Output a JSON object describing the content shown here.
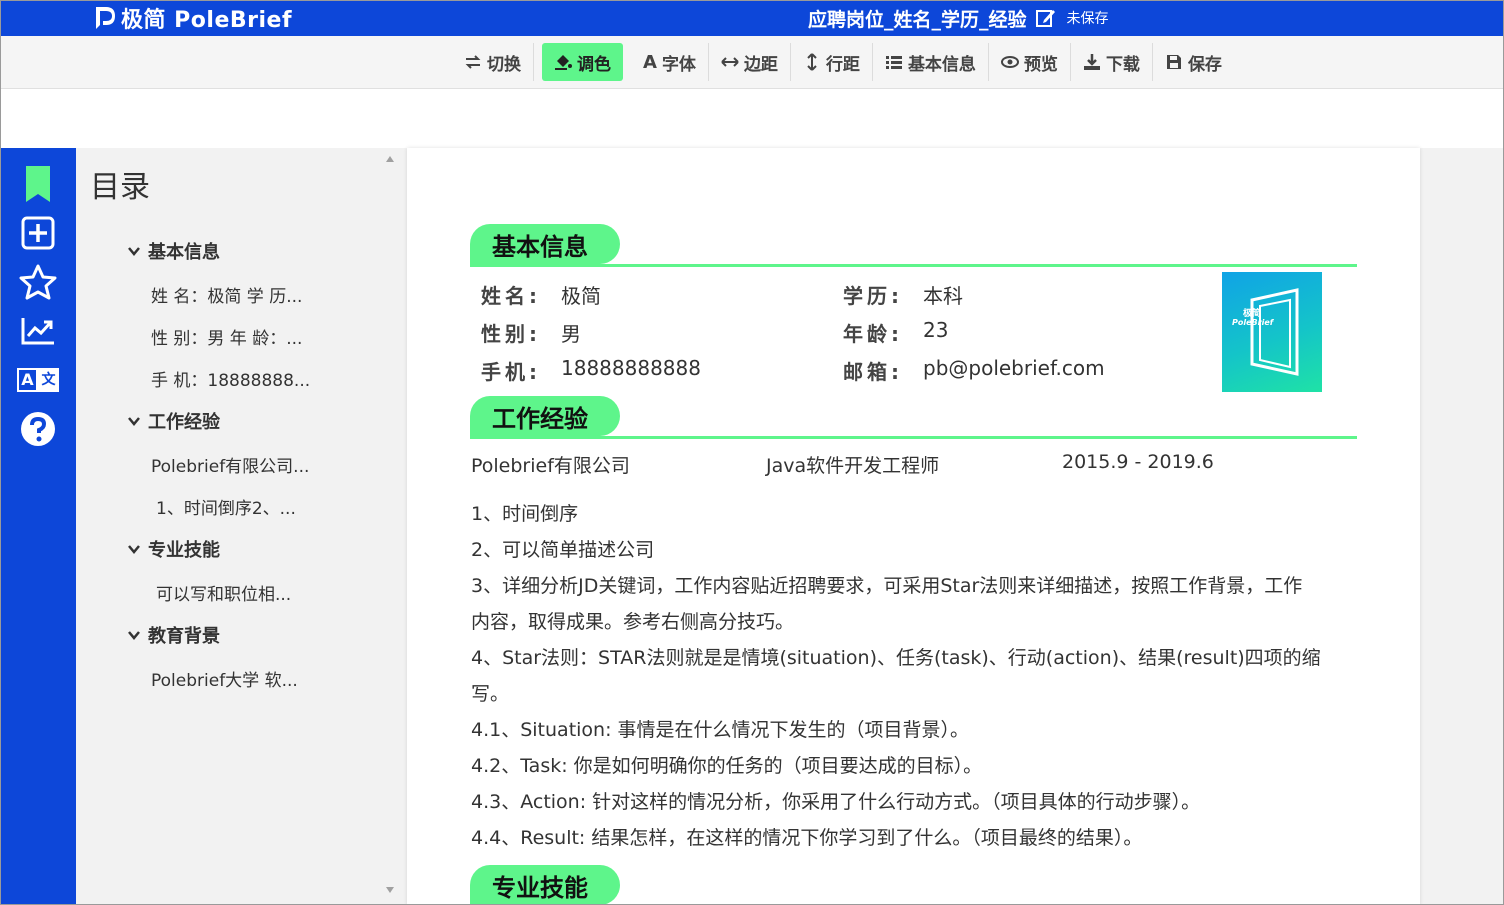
{
  "app": {
    "logo_text": "极简 PoleBrief",
    "doc_title": "应聘岗位_姓名_学历_经验",
    "save_status": "未保存"
  },
  "toolbar": {
    "items": [
      {
        "label": "切换",
        "icon": "swap-icon"
      },
      {
        "label": "调色",
        "icon": "paint-bucket-icon",
        "active": true
      },
      {
        "label": "字体",
        "icon": "font-icon"
      },
      {
        "label": "边距",
        "icon": "horizontal-arrows-icon"
      },
      {
        "label": "行距",
        "icon": "vertical-arrows-icon"
      },
      {
        "label": "基本信息",
        "icon": "list-icon"
      },
      {
        "label": "预览",
        "icon": "eye-icon"
      },
      {
        "label": "下载",
        "icon": "download-icon"
      },
      {
        "label": "保存",
        "icon": "save-icon"
      }
    ]
  },
  "rail": {
    "icons": [
      "bookmark-icon",
      "add-box-icon",
      "star-icon",
      "chart-icon",
      "translate-icon",
      "help-icon"
    ],
    "translate_letters": [
      "A",
      "文"
    ]
  },
  "toc": {
    "title": "目录",
    "sections": [
      {
        "label": "基本信息",
        "items": [
          "姓 名：极简 学 历...",
          "性 别：男 年 龄：...",
          "手 机：18888888..."
        ]
      },
      {
        "label": "工作经验",
        "items": [
          "Polebrief有限公司...",
          "1、时间倒序2、..."
        ]
      },
      {
        "label": "专业技能",
        "items": [
          "可以写和职位相..."
        ]
      },
      {
        "label": "教育背景",
        "items": [
          "Polebrief大学 软..."
        ]
      }
    ]
  },
  "resume": {
    "basic": {
      "heading": "基本信息",
      "name_label": "姓名:",
      "name_value": "极简",
      "edu_label": "学历:",
      "edu_value": "本科",
      "gender_label": "性别:",
      "gender_value": "男",
      "age_label": "年龄:",
      "age_value": "23",
      "phone_label": "手机:",
      "phone_value": "18888888888",
      "email_label": "邮箱:",
      "email_value": "pb@polebrief.com",
      "photo_text_1": "极简",
      "photo_text_2": "PoleBrief"
    },
    "work": {
      "heading": "工作经验",
      "company": "Polebrief有限公司",
      "position": "Java软件开发工程师",
      "period": "2015.9 - 2019.6",
      "lines": [
        "1、时间倒序",
        "2、可以简单描述公司",
        "3、详细分析JD关键词，工作内容贴近招聘要求，可采用Star法则来详细描述，按照工作背景，工作",
        "内容，取得成果。参考右侧高分技巧。",
        "4、Star法则：STAR法则就是是情境(situation)、任务(task)、行动(action)、结果(result)四项的缩",
        "写。",
        "4.1、Situation: 事情是在什么情况下发生的（项目背景）。",
        "4.2、Task: 你是如何明确你的任务的（项目要达成的目标）。",
        "4.3、Action: 针对这样的情况分析，你采用了什么行动方式。（项目具体的行动步骤）。",
        "4.4、Result: 结果怎样，在这样的情况下你学习到了什么。（项目最终的结果）。"
      ]
    },
    "skills": {
      "heading": "专业技能"
    }
  },
  "colors": {
    "brand_blue": "#0d47d9",
    "accent_green": "#5ef58b"
  }
}
